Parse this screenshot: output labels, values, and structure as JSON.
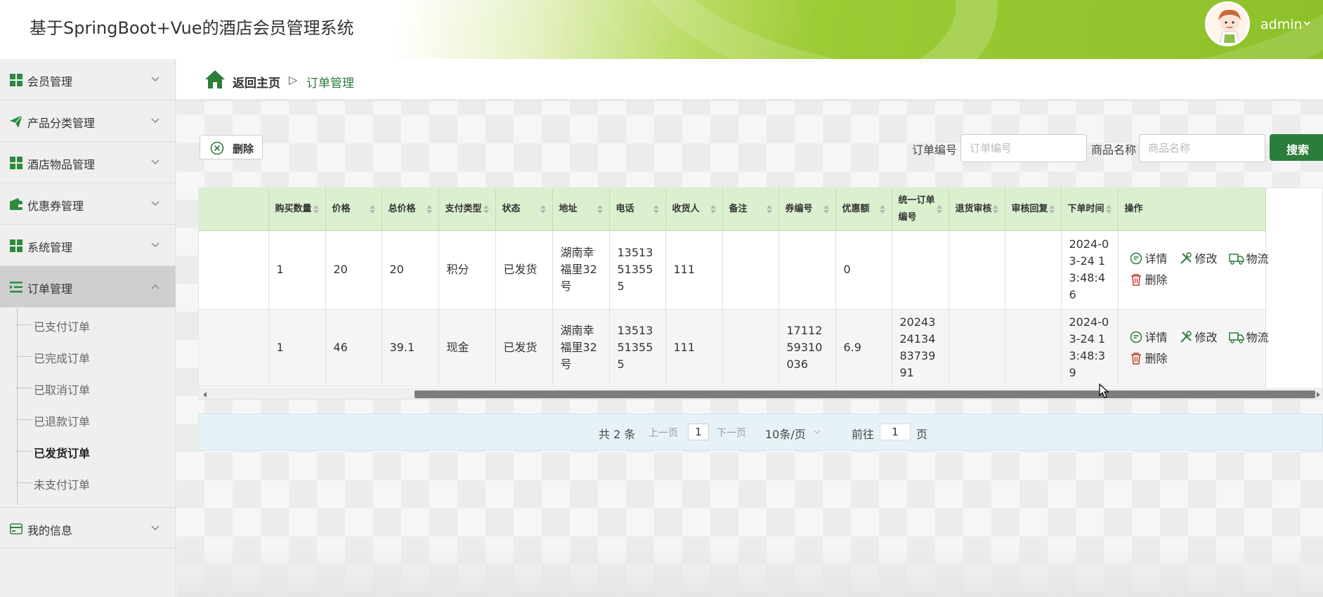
{
  "app": {
    "title": "基于SpringBoot+Vue的酒店会员管理系统",
    "user": "admin"
  },
  "colors": {
    "accent": "#2b7d3a",
    "header_green": "#8dc02a",
    "table_header": "#daf0cf"
  },
  "sidebar": {
    "items": [
      {
        "label": "会员管理",
        "icon": "grid-icon"
      },
      {
        "label": "产品分类管理",
        "icon": "paper-plane-icon"
      },
      {
        "label": "酒店物品管理",
        "icon": "grid-icon"
      },
      {
        "label": "优惠券管理",
        "icon": "wallet-icon"
      },
      {
        "label": "系统管理",
        "icon": "grid-icon"
      },
      {
        "label": "订单管理",
        "icon": "list-icon"
      },
      {
        "label": "我的信息",
        "icon": "card-icon"
      }
    ],
    "submenu": [
      "已支付订单",
      "已完成订单",
      "已取消订单",
      "已退款订单",
      "已发货订单",
      "未支付订单"
    ],
    "active_sub": "已发货订单"
  },
  "breadcrumb": {
    "home": "返回主页",
    "separator": "▷",
    "current": "订单管理"
  },
  "toolbar": {
    "delete_label": "删除",
    "order_no_label": "订单编号",
    "order_no_placeholder": "订单编号",
    "product_name_label": "商品名称",
    "product_name_placeholder": "商品名称",
    "search_label": "搜索"
  },
  "table": {
    "headers": [
      "购买数量",
      "价格",
      "总价格",
      "支付类型",
      "状态",
      "地址",
      "电话",
      "收货人",
      "备注",
      "券编号",
      "优惠额",
      "统一订单编号",
      "退货审核",
      "审核回复",
      "下单时间",
      "操作"
    ],
    "rows": [
      {
        "cells": [
          "1",
          "20",
          "20",
          "积分",
          "已发货",
          "湖南幸福里32号",
          "13513513555",
          "111",
          "",
          "",
          "0",
          "",
          "",
          "",
          "2024-03-24 13:48:46"
        ]
      },
      {
        "cells": [
          "1",
          "46",
          "39.1",
          "现金",
          "已发货",
          "湖南幸福里32号",
          "13513513555",
          "111",
          "",
          "1711259310036",
          "6.9",
          "20243241348373991",
          "",
          "",
          "2024-03-24 13:48:39"
        ]
      }
    ],
    "actions": {
      "detail": "详情",
      "edit": "修改",
      "logistics": "物流",
      "delete": "删除"
    }
  },
  "pagination": {
    "total": "共 2 条",
    "prev": "上一页",
    "current": "1",
    "next": "下一页",
    "page_size": "10条/页",
    "goto_label": "前往",
    "goto_value": "1",
    "page_suffix": "页"
  }
}
